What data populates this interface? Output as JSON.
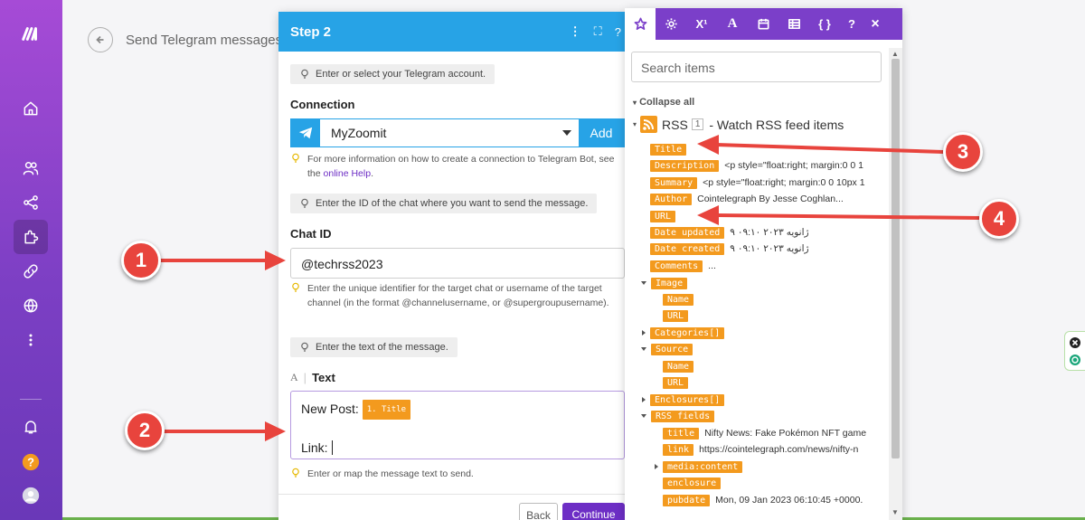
{
  "scenario": {
    "title": "Send Telegram messages"
  },
  "step_panel": {
    "title": "Step 2",
    "hint_account": "Enter or select your Telegram account.",
    "connection_label": "Connection",
    "connection_value": "MyZoomit",
    "add_label": "Add",
    "conn_help_pre": "For more information on how to create a connection to Telegram Bot, see the",
    "conn_help_link": "online Help",
    "conn_help_post": ".",
    "hint_chat": "Enter the ID of the chat where you want to send the message.",
    "chat_label": "Chat ID",
    "chat_value": "@techrss2023",
    "chat_help": "Enter the unique identifier for the target chat or username of the target channel (in the format @channelusername, or @supergroupusername).",
    "hint_text": "Enter the text of the message.",
    "text_label": "Text",
    "text_line1": "New Post:",
    "text_pill": "1. Title",
    "text_line2": "Link:",
    "text_help": "Enter or map the message text to send.",
    "back_label": "Back",
    "continue_label": "Continue"
  },
  "picker": {
    "tabs": [
      {
        "icon": "star-icon"
      },
      {
        "icon": "gear-icon"
      },
      {
        "icon": "superscript-icon",
        "label": "X¹"
      },
      {
        "icon": "text-icon",
        "label": "A"
      },
      {
        "icon": "calendar-icon"
      },
      {
        "icon": "table-icon"
      },
      {
        "icon": "braces-icon",
        "label": "{ }"
      },
      {
        "icon": "help-icon",
        "label": "?"
      },
      {
        "icon": "close-icon",
        "label": "×"
      }
    ],
    "search_placeholder": "Search items",
    "collapse_all": "Collapse all",
    "module_name": "RSS",
    "module_num": "1",
    "module_desc": "- Watch RSS feed items",
    "items": [
      {
        "label": "Title",
        "value": ""
      },
      {
        "label": "Description",
        "value": "<p style=\"float:right; margin:0 0 1"
      },
      {
        "label": "Summary",
        "value": "<p style=\"float:right; margin:0 0 10px 1"
      },
      {
        "label": "Author",
        "value": "Cointelegraph By Jesse Coghlan..."
      },
      {
        "label": "URL",
        "value": ""
      },
      {
        "label": "Date updated",
        "value": "۹ ژانویه ۲۰۲۳ ۰۹:۱۰"
      },
      {
        "label": "Date created",
        "value": "۹ ژانویه ۲۰۲۳ ۰۹:۱۰"
      },
      {
        "label": "Comments",
        "value": "..."
      },
      {
        "label": "Image",
        "value": ""
      },
      {
        "label": "Name",
        "value": ""
      },
      {
        "label": "URL",
        "value": ""
      },
      {
        "label": "Categories[]",
        "value": ""
      },
      {
        "label": "Source",
        "value": ""
      },
      {
        "label": "Name",
        "value": ""
      },
      {
        "label": "URL",
        "value": ""
      },
      {
        "label": "Enclosures[]",
        "value": ""
      },
      {
        "label": "RSS fields",
        "value": ""
      },
      {
        "label": "title",
        "value": "Nifty News: Fake Pokémon NFT game"
      },
      {
        "label": "link",
        "value": "https://cointelegraph.com/news/nifty-n"
      },
      {
        "label": "media:content",
        "value": ""
      },
      {
        "label": "enclosure",
        "value": ""
      },
      {
        "label": "pubdate",
        "value": "Mon, 09 Jan 2023 06:10:45 +0000."
      }
    ]
  },
  "markers": [
    "1",
    "2",
    "3",
    "4"
  ],
  "colors": {
    "brand_purple": "#7b3fc9",
    "telegram_blue": "#27a3e6",
    "pill_orange": "#f39a1e",
    "marker_red": "#e8443d"
  }
}
